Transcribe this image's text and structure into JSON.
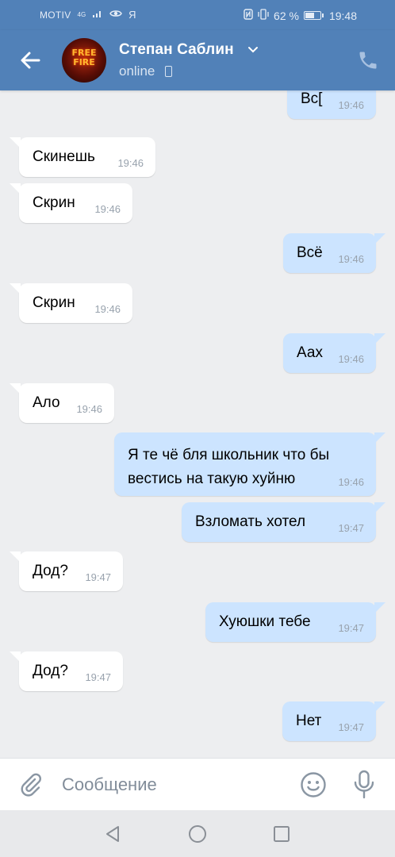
{
  "status_bar": {
    "carrier": "MOTIV",
    "network": "4G",
    "yandex": "Я",
    "battery_text": "62 %",
    "battery_level": 0.62,
    "time": "19:48"
  },
  "header": {
    "contact_name": "Степан Саблин",
    "status": "online",
    "avatar_text_1": "FREE",
    "avatar_text_2": "FIRE"
  },
  "messages": [
    {
      "dir": "out",
      "text": "Вс[",
      "time": "19:46"
    },
    {
      "dir": "in",
      "text": "Скинешь",
      "time": "19:46"
    },
    {
      "dir": "in",
      "text": "Скрин",
      "time": "19:46"
    },
    {
      "dir": "out",
      "text": "Всё",
      "time": "19:46"
    },
    {
      "dir": "in",
      "text": "Скрин",
      "time": "19:46"
    },
    {
      "dir": "out",
      "text": "Аах",
      "time": "19:46"
    },
    {
      "dir": "in",
      "text": "Ало",
      "time": "19:46"
    },
    {
      "dir": "out",
      "text": "Я те чё бля школьник что бы вестись на такую хуйню",
      "time": "19:46"
    },
    {
      "dir": "out",
      "text": "Взломать хотел",
      "time": "19:47"
    },
    {
      "dir": "in",
      "text": "Дод?",
      "time": "19:47"
    },
    {
      "dir": "out",
      "text": "Хуюшки тебе",
      "time": "19:47"
    },
    {
      "dir": "in",
      "text": "Дод?",
      "time": "19:47"
    },
    {
      "dir": "out",
      "text": "Нет",
      "time": "19:47"
    }
  ],
  "composer": {
    "placeholder": "Сообщение"
  },
  "icons": {
    "back": "arrow-left-icon",
    "call": "phone-icon",
    "attach": "paperclip-icon",
    "emoji": "smiley-icon",
    "mic": "microphone-icon",
    "nav_back": "triangle-back-icon",
    "nav_home": "circle-home-icon",
    "nav_recent": "square-recent-icon"
  },
  "colors": {
    "header_bg": "#5181b8",
    "chat_bg": "#edeef0",
    "incoming_bubble": "#ffffff",
    "outgoing_bubble": "#cce4ff",
    "timestamp": "#98a2ad"
  }
}
